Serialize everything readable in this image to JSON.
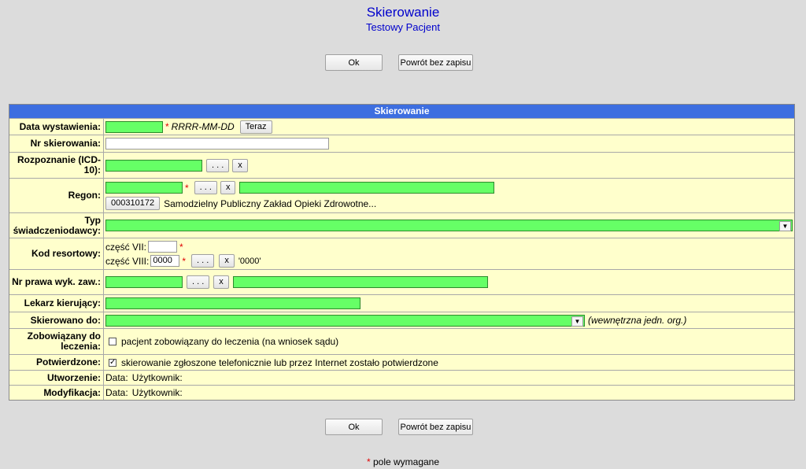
{
  "header": {
    "title": "Skierowanie",
    "patient": "Testowy Pacjent"
  },
  "buttons": {
    "ok": "Ok",
    "back": "Powrót bez zapisu"
  },
  "form": {
    "title": "Skierowanie",
    "labels": {
      "date": "Data wystawienia:",
      "number": "Nr skierowania:",
      "diagnosis": "Rozpoznanie (ICD-10):",
      "regon": "Regon:",
      "provider_type": "Typ świadczeniodawcy:",
      "dept_code": "Kod resortowy:",
      "license": "Nr prawa wyk. zaw.:",
      "doctor": "Lekarz kierujący:",
      "referred_to": "Skierowano do:",
      "obliged": "Zobowiązany do leczenia:",
      "confirmed": "Potwierdzone:",
      "created": "Utworzenie:",
      "modified": "Modyfikacja:"
    },
    "date_format": "RRRR-MM-DD",
    "now_button": "Teraz",
    "browse_button": ". . .",
    "clear_button": "x",
    "regon_code": "000310172",
    "regon_name": "Samodzielny Publiczny Zakład Opieki Zdrowotne...",
    "part7_label": "część VII:",
    "part8_label": "część VIII:",
    "part8_value": "0000",
    "part8_hint": "'0000'",
    "referred_hint": "(wewnętrzna jedn. org.)",
    "obliged_text": "pacjent zobowiązany do leczenia (na wniosek sądu)",
    "obliged_checked": false,
    "confirmed_text": "skierowanie zgłoszone telefonicznie lub przez Internet zostało potwierdzone",
    "confirmed_checked": true,
    "data_label": "Data:",
    "user_label": "Użytkownik:"
  },
  "footer": {
    "asterisk": "*",
    "required": "pole wymagane"
  },
  "colors": {
    "required_field": "#66ff66",
    "title_bar": "#3d6ee0",
    "form_bg": "#ffffcc",
    "header_text": "#0000cc"
  }
}
